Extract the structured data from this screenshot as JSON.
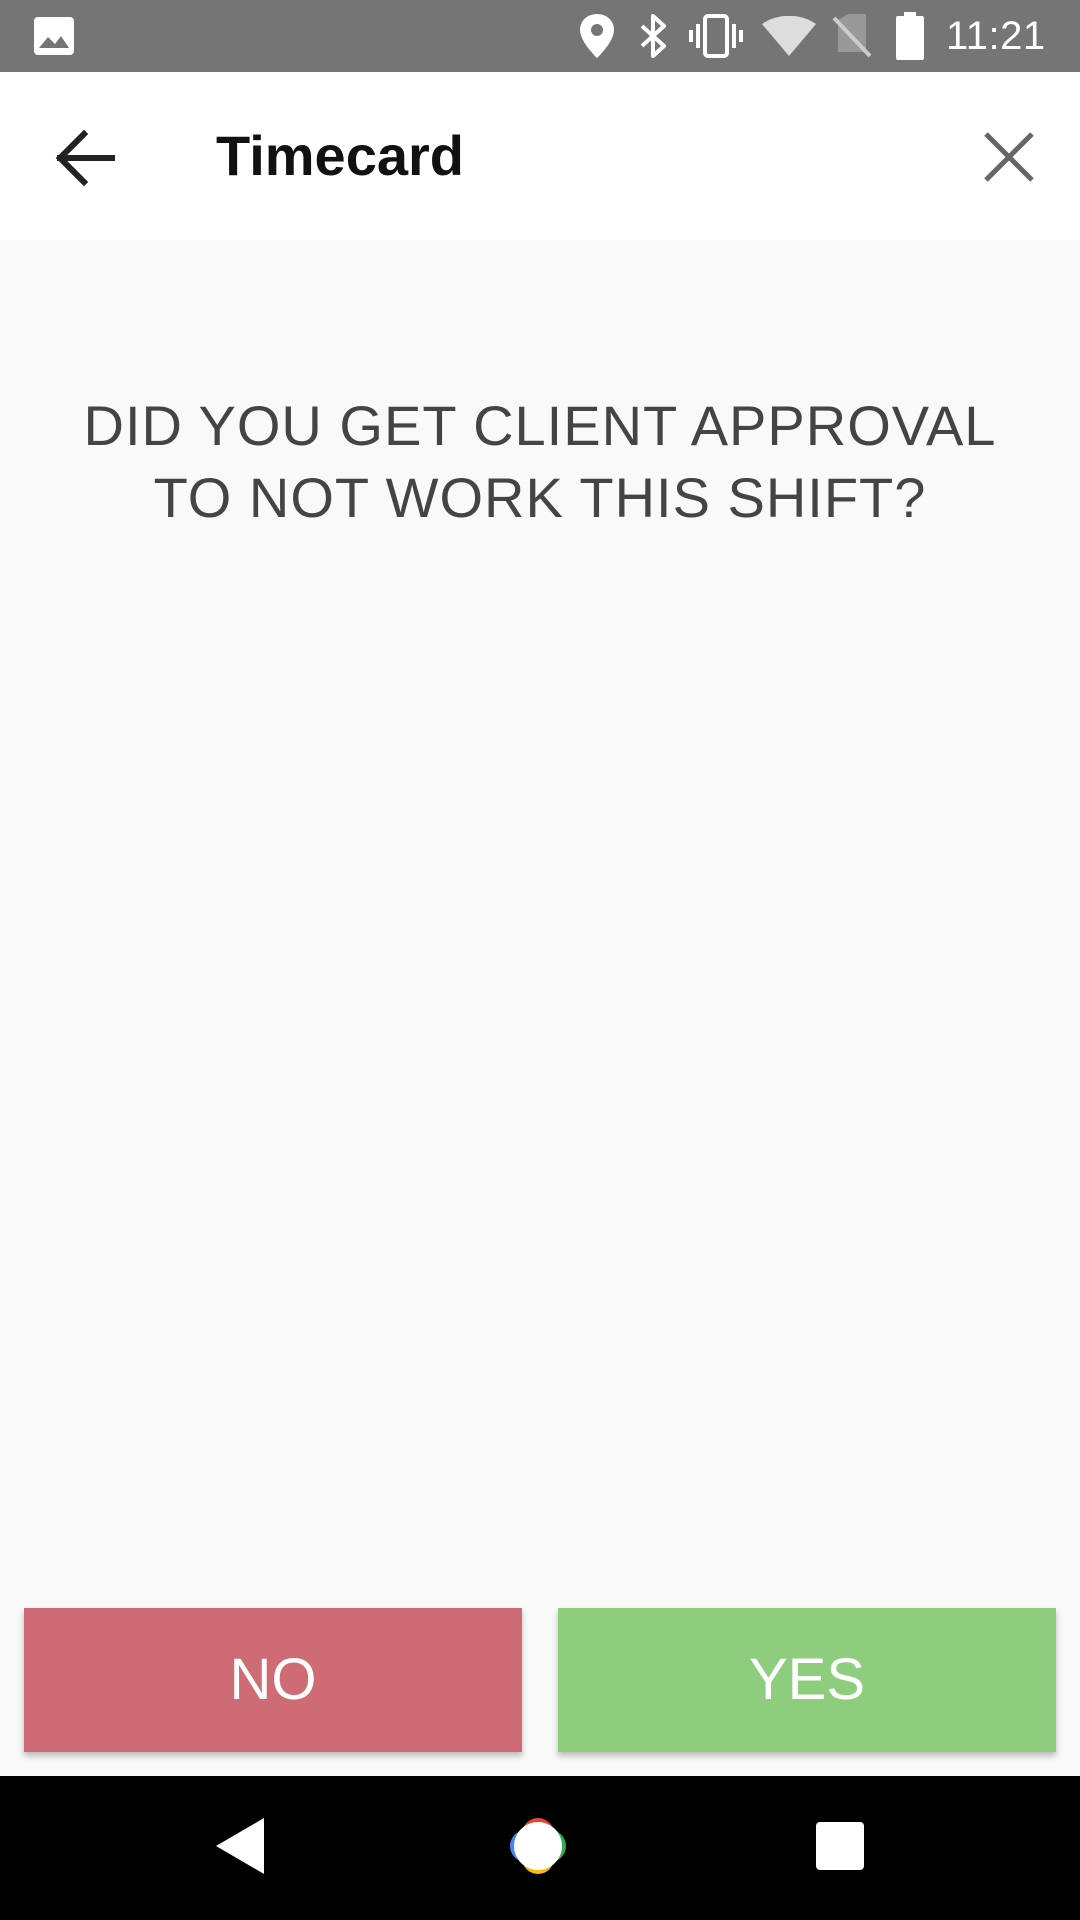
{
  "status_bar": {
    "time": "11:21",
    "icons": [
      "image-icon",
      "location-icon",
      "bluetooth-icon",
      "vibrate-icon",
      "wifi-icon",
      "no-sim-icon",
      "battery-icon"
    ]
  },
  "app_bar": {
    "title": "Timecard",
    "back_icon": "arrow-back-icon",
    "close_icon": "close-icon"
  },
  "main": {
    "question": "DID YOU GET CLIENT APPROVAL TO NOT WORK THIS SHIFT?"
  },
  "actions": {
    "no_label": "NO",
    "yes_label": "YES",
    "no_color": "#cf6b75",
    "yes_color": "#8fcd7e"
  },
  "nav_bar": {
    "icons": [
      "nav-back-icon",
      "nav-home-icon",
      "nav-recents-icon"
    ]
  }
}
